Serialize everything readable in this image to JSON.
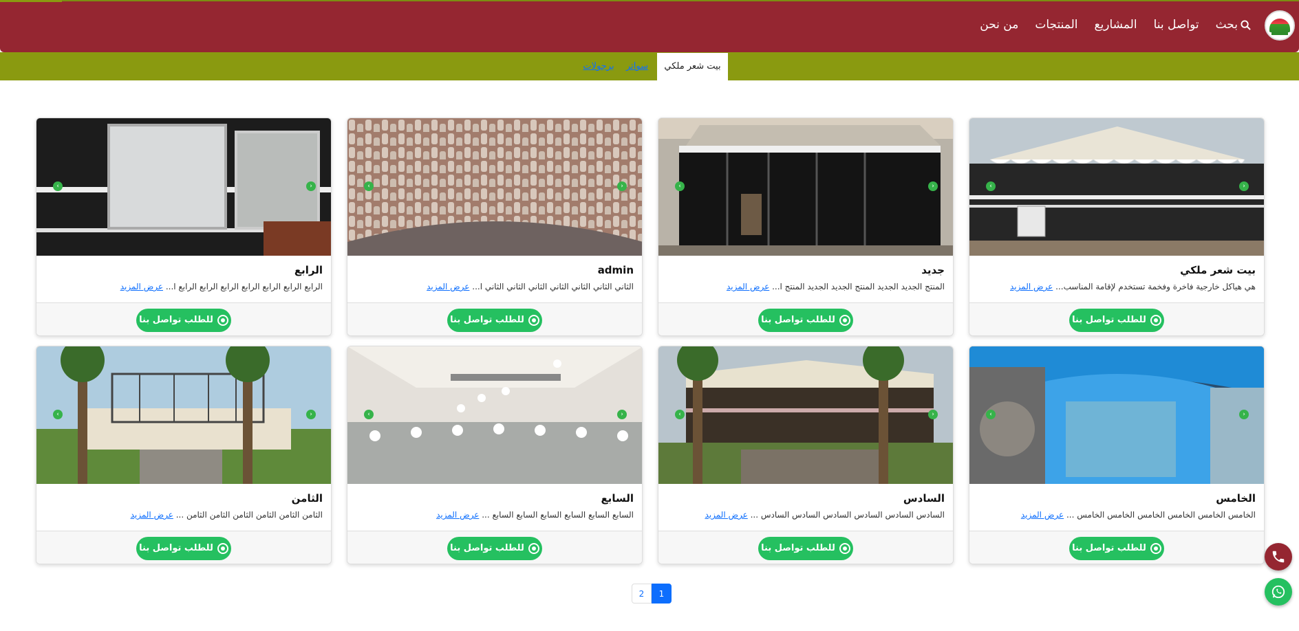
{
  "nav": {
    "links": [
      "من نحن",
      "المنتجات",
      "المشاريع",
      "تواصل بنا",
      "بحث"
    ]
  },
  "tabs": [
    "بيت شعر ملكي",
    "سواتر",
    "برجولات"
  ],
  "cards": [
    {
      "title": "بيت شعر ملكي",
      "desc": "هي هياكل خارجية فاخرة وفخمة تستخدم لإقامة المناسب...",
      "more": "عرض المزيد",
      "button": "للطلب تواصل بنا"
    },
    {
      "title": "جديد",
      "desc": "المنتج الجديد الجديد المنتج الجديد الجديد المنتج ا...",
      "more": "عرض المزيد",
      "button": "للطلب تواصل بنا"
    },
    {
      "title": "admin",
      "desc": "الثاني الثاني الثاني الثاني الثاني الثاني الثاني ا...",
      "more": "عرض المزيد",
      "button": "للطلب تواصل بنا"
    },
    {
      "title": "الرابع",
      "desc": "الرابع الرابع الرابع الرابع الرابع الرابع الرابع ا...",
      "more": "عرض المزيد",
      "button": "للطلب تواصل بنا"
    },
    {
      "title": "الخامس",
      "desc": "الخامس الخامس الخامس الخامس الخامس الخامس ...",
      "more": "عرض المزيد",
      "button": "للطلب تواصل بنا"
    },
    {
      "title": "السادس",
      "desc": "السادس السادس السادس السادس السادس السادس ...",
      "more": "عرض المزيد",
      "button": "للطلب تواصل بنا"
    },
    {
      "title": "السابع",
      "desc": "السابع السابع السابع السابع السابع السابع ...",
      "more": "عرض المزيد",
      "button": "للطلب تواصل بنا"
    },
    {
      "title": "الثامن",
      "desc": "الثامن الثامن الثامن الثامن الثامن الثامن ...",
      "more": "عرض المزيد",
      "button": "للطلب تواصل بنا"
    }
  ],
  "pagination": {
    "pages": [
      "2",
      "1"
    ],
    "active": "1"
  },
  "colors": {
    "brand": "#952631",
    "accent": "#8a9a10",
    "whatsapp": "#25c060",
    "link": "#0d6efd"
  }
}
